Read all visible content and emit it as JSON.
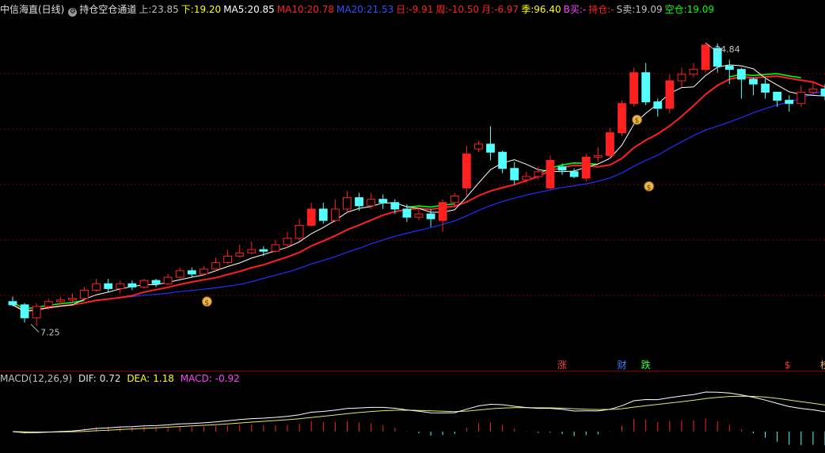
{
  "header": {
    "title": "中信海直(日线)",
    "indicator_name": "持仓空仓通道",
    "items": [
      {
        "label": "上:",
        "value": "23.85",
        "color": "#c0c0c0"
      },
      {
        "label": "下:",
        "value": "19.20",
        "color": "#ffff00"
      },
      {
        "label": "MA5:",
        "value": "20.85",
        "color": "#ffffff"
      },
      {
        "label": "MA10:",
        "value": "20.78",
        "color": "#ff2020"
      },
      {
        "label": "MA20:",
        "value": "21.53",
        "color": "#3050ff"
      },
      {
        "label": "日:",
        "value": "-9.91",
        "color": "#ff2020"
      },
      {
        "label": "周:",
        "value": "-10.50",
        "color": "#ff2020"
      },
      {
        "label": "月:",
        "value": "-6.97",
        "color": "#ff2020"
      },
      {
        "label": "季:",
        "value": "96.40",
        "color": "#ffff00"
      },
      {
        "label": "B买:",
        "value": "-",
        "color": "#ff40ff"
      },
      {
        "label": "持仓:",
        "value": "-",
        "color": "#ff2020"
      },
      {
        "label": "S卖:",
        "value": "19.09",
        "color": "#c0c0c0"
      },
      {
        "label": "空仓:",
        "value": "19.09",
        "color": "#00ff00"
      }
    ]
  },
  "price_labels": {
    "high": "24.84",
    "low": "7.25"
  },
  "macd_header": {
    "name": "MACD(12,26,9)",
    "dif": {
      "label": "DIF:",
      "value": "0.72",
      "color": "#e0e0e0"
    },
    "dea": {
      "label": "DEA:",
      "value": "1.18",
      "color": "#ffff00"
    },
    "macd": {
      "label": "MACD:",
      "value": "-0.92",
      "color": "#ff40ff"
    }
  },
  "event_markers": [
    {
      "text": "涨",
      "color": "#ff4040",
      "bar": 46
    },
    {
      "text": "财",
      "color": "#4080ff",
      "bar": 51
    },
    {
      "text": "跌",
      "color": "#40ff40",
      "bar": 53
    },
    {
      "text": "$",
      "color": "#ff3030",
      "bar": 65
    },
    {
      "text": "榜",
      "color": "#ffb070",
      "bar": 68
    }
  ],
  "colors": {
    "up": "#ff2020",
    "down": "#54ffff",
    "ma5": "#ffffff",
    "ma10": "#ff2020",
    "ma20": "#2030ff",
    "green_line": "#00ff00",
    "grid": "#7a0000",
    "dea": "#e8e860",
    "dif": "#ffffff"
  },
  "chart_data": {
    "type": "candlestick",
    "ylim": [
      6.5,
      26.5
    ],
    "x_count": 69,
    "candles": [
      [
        8.9,
        8.7,
        9.2,
        8.6
      ],
      [
        8.7,
        7.9,
        8.8,
        7.6
      ],
      [
        7.9,
        8.6,
        8.8,
        7.4
      ],
      [
        8.6,
        8.9,
        9.1,
        8.4
      ],
      [
        8.9,
        9.0,
        9.2,
        8.7
      ],
      [
        9.0,
        9.1,
        9.4,
        8.9
      ],
      [
        9.1,
        9.6,
        9.8,
        9.0
      ],
      [
        9.6,
        10.0,
        10.3,
        9.5
      ],
      [
        10.0,
        9.7,
        10.3,
        9.5
      ],
      [
        9.7,
        10.0,
        10.2,
        9.4
      ],
      [
        10.0,
        9.8,
        10.2,
        9.6
      ],
      [
        9.8,
        10.2,
        10.3,
        9.7
      ],
      [
        10.2,
        10.0,
        10.3,
        9.8
      ],
      [
        10.0,
        10.4,
        10.6,
        9.9
      ],
      [
        10.4,
        10.8,
        11.0,
        10.3
      ],
      [
        10.8,
        10.6,
        11.0,
        10.4
      ],
      [
        10.6,
        10.9,
        11.1,
        10.5
      ],
      [
        10.9,
        11.3,
        11.6,
        10.8
      ],
      [
        11.3,
        11.7,
        12.1,
        11.2
      ],
      [
        11.7,
        11.9,
        12.4,
        11.6
      ],
      [
        11.9,
        12.1,
        12.6,
        11.8
      ],
      [
        12.1,
        12.0,
        12.3,
        11.7
      ],
      [
        12.0,
        12.4,
        12.7,
        11.9
      ],
      [
        12.4,
        12.8,
        13.2,
        12.2
      ],
      [
        12.8,
        13.6,
        14.0,
        12.6
      ],
      [
        13.6,
        14.6,
        15.0,
        13.5
      ],
      [
        14.6,
        13.9,
        15.0,
        13.7
      ],
      [
        13.9,
        14.6,
        15.2,
        13.8
      ],
      [
        14.6,
        15.3,
        15.7,
        14.4
      ],
      [
        15.3,
        14.8,
        15.6,
        14.5
      ],
      [
        14.8,
        15.2,
        15.6,
        14.6
      ],
      [
        15.2,
        15.0,
        15.5,
        14.6
      ],
      [
        15.0,
        14.6,
        15.2,
        14.3
      ],
      [
        14.6,
        14.1,
        14.9,
        13.8
      ],
      [
        14.1,
        14.3,
        14.7,
        13.9
      ],
      [
        14.3,
        14.0,
        14.6,
        13.5
      ],
      [
        13.9,
        15.0,
        15.2,
        13.2
      ],
      [
        15.0,
        15.4,
        15.6,
        14.7
      ],
      [
        15.9,
        18.0,
        18.5,
        15.4
      ],
      [
        18.3,
        18.6,
        18.8,
        18.1
      ],
      [
        18.6,
        18.1,
        19.7,
        17.6
      ],
      [
        18.1,
        17.1,
        18.2,
        16.8
      ],
      [
        17.1,
        16.4,
        17.5,
        16.1
      ],
      [
        16.4,
        16.6,
        16.9,
        16.2
      ],
      [
        16.6,
        16.9,
        17.2,
        16.4
      ],
      [
        15.9,
        17.6,
        17.9,
        15.8
      ],
      [
        17.2,
        17.0,
        17.4,
        16.7
      ],
      [
        16.9,
        16.6,
        17.1,
        16.5
      ],
      [
        16.5,
        17.8,
        18.0,
        16.3
      ],
      [
        17.8,
        17.9,
        18.4,
        17.5
      ],
      [
        17.9,
        19.3,
        19.6,
        17.7
      ],
      [
        19.3,
        21.1,
        21.3,
        19.1
      ],
      [
        21.1,
        23.0,
        23.3,
        20.9
      ],
      [
        23.0,
        21.2,
        23.6,
        21.0
      ],
      [
        21.2,
        20.8,
        21.4,
        20.3
      ],
      [
        20.8,
        22.5,
        22.9,
        20.5
      ],
      [
        22.5,
        22.9,
        23.3,
        22.1
      ],
      [
        22.9,
        23.2,
        23.6,
        22.7
      ],
      [
        23.2,
        24.7,
        24.84,
        23.0
      ],
      [
        24.5,
        23.4,
        24.8,
        23.0
      ],
      [
        23.4,
        23.2,
        23.8,
        22.3
      ],
      [
        23.2,
        22.6,
        23.3,
        21.4
      ],
      [
        22.6,
        22.3,
        22.7,
        21.6
      ],
      [
        22.3,
        21.8,
        22.6,
        21.4
      ],
      [
        21.8,
        21.3,
        21.8,
        20.9
      ],
      [
        21.3,
        21.1,
        21.6,
        20.6
      ],
      [
        21.1,
        21.8,
        22.2,
        20.9
      ],
      [
        21.8,
        22.0,
        22.4,
        21.7
      ],
      [
        22.0,
        21.6,
        22.3,
        21.3
      ]
    ]
  }
}
